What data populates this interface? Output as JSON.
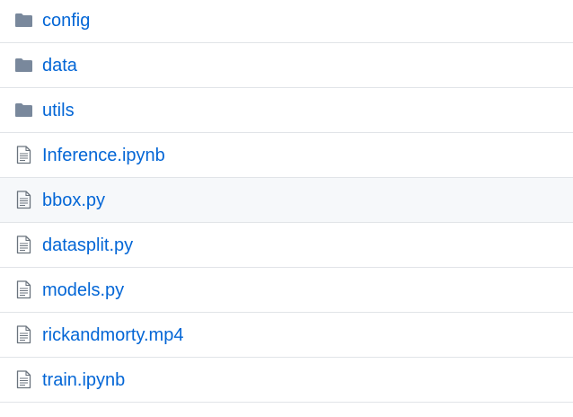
{
  "colors": {
    "link": "#0366d6",
    "folder_icon": "#79889c",
    "file_icon": "#6a737d",
    "row_border": "#e1e4e8",
    "row_hover_bg": "#f6f8fa"
  },
  "files": [
    {
      "name": "config",
      "icon": "folder-icon",
      "type": "directory"
    },
    {
      "name": "data",
      "icon": "folder-icon",
      "type": "directory"
    },
    {
      "name": "utils",
      "icon": "folder-icon",
      "type": "directory"
    },
    {
      "name": "Inference.ipynb",
      "icon": "file-icon",
      "type": "file"
    },
    {
      "name": "bbox.py",
      "icon": "file-icon",
      "type": "file",
      "hovered": true
    },
    {
      "name": "datasplit.py",
      "icon": "file-icon",
      "type": "file"
    },
    {
      "name": "models.py",
      "icon": "file-icon",
      "type": "file"
    },
    {
      "name": "rickandmorty.mp4",
      "icon": "file-icon",
      "type": "file"
    },
    {
      "name": "train.ipynb",
      "icon": "file-icon",
      "type": "file"
    }
  ]
}
